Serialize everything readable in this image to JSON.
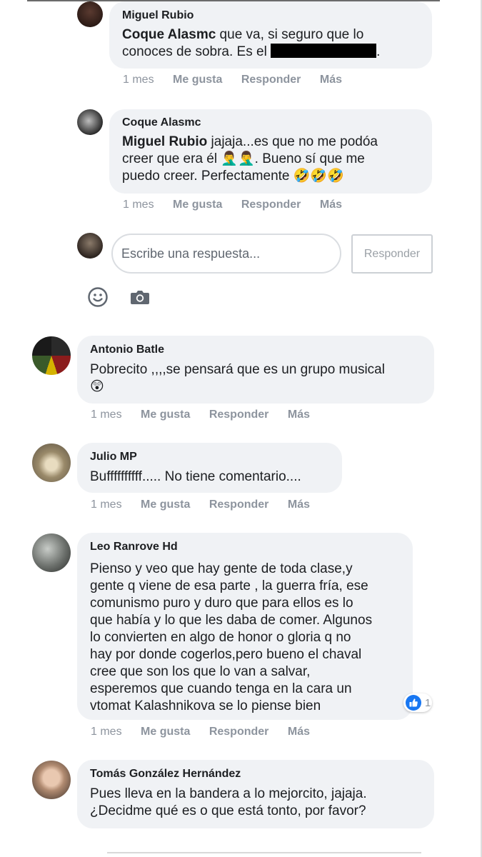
{
  "comments": [
    {
      "author": "Miguel Rubio",
      "mention": "Coque Alasmc",
      "text_line1": " que va, si seguro que lo",
      "text_line2_a": "conoces de sobra. Es el ",
      "text_line2_b": ".",
      "time": "1 mes",
      "like": "Me gusta",
      "reply": "Responder",
      "more": "Más"
    },
    {
      "author": "Coque Alasmc",
      "mention": "Miguel Rubio",
      "text_line1": " jajaja...es que no me podóa",
      "text_line2": "creer que era él 🤦‍♂️🤦‍♂️. Bueno sí que me",
      "text_line3": "puedo creer. Perfectamente 🤣🤣🤣",
      "time": "1 mes",
      "like": "Me gusta",
      "reply": "Responder",
      "more": "Más"
    },
    {
      "author": "Antonio Batle",
      "text_line1": "Pobrecito ,,,,se pensará que es un grupo musical",
      "text_line2": "😲",
      "time": "1 mes",
      "like": "Me gusta",
      "reply": "Responder",
      "more": "Más"
    },
    {
      "author": "Julio MP",
      "text_line1": "Buffffffffff..... No tiene comentario....",
      "time": "1 mes",
      "like": "Me gusta",
      "reply": "Responder",
      "more": "Más"
    },
    {
      "author": "Leo Ranrove Hd",
      "lines": [
        "Pienso y veo que hay gente de toda clase,y",
        "gente q viene de esa parte , la guerra fría, ese",
        "comunismo puro y duro que para ellos es lo",
        "que había y lo que les daba de comer. Algunos",
        "lo convierten en algo de honor o gloria q no",
        "hay por donde cogerlos,pero bueno el chaval",
        "cree que son los que lo van a salvar,",
        "esperemos que cuando tenga en la cara un",
        "vtomat Kalashnikova se lo piense bien"
      ],
      "reaction_count": "1",
      "time": "1 mes",
      "like": "Me gusta",
      "reply": "Responder",
      "more": "Más"
    },
    {
      "author": "Tomás González Hernández",
      "text_line1": "Pues lleva en la bandera a lo mejorcito, jajaja.",
      "text_line2": "¿Decidme qué es o que está tonto, por favor?"
    }
  ],
  "reply_box": {
    "placeholder": "Escribe una respuesta...",
    "button": "Responder"
  },
  "icons": {
    "emoji": "smiley-icon",
    "camera": "camera-icon",
    "like_reaction": "thumbs-up-icon"
  },
  "colors": {
    "bubble": "#f0f2f5",
    "meta": "#8d949e",
    "like_blue": "#1877f2"
  }
}
